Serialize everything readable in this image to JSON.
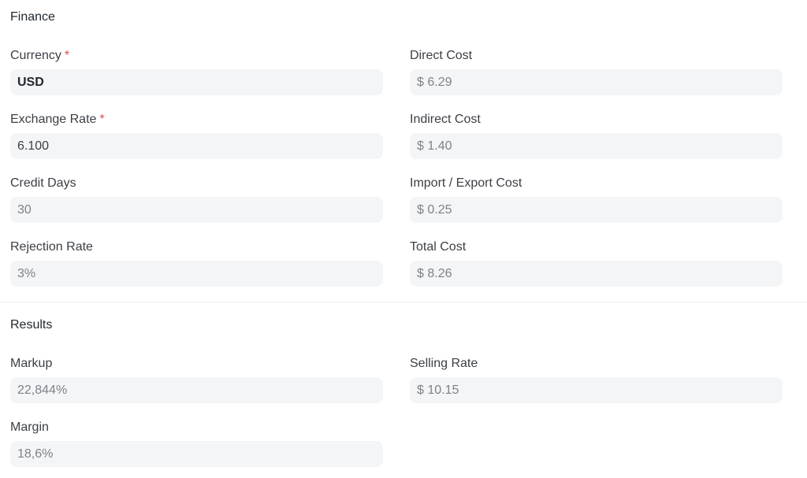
{
  "finance": {
    "title": "Finance",
    "required_mark": "*",
    "left": [
      {
        "key": "currency",
        "label": "Currency",
        "value": "USD",
        "required": true
      },
      {
        "key": "exchange_rate",
        "label": "Exchange Rate",
        "value": "6.100",
        "required": true
      },
      {
        "key": "credit_days",
        "label": "Credit Days",
        "value": "30",
        "required": false
      },
      {
        "key": "rejection_rate",
        "label": "Rejection Rate",
        "value": "3%",
        "required": false
      }
    ],
    "right": [
      {
        "key": "direct_cost",
        "label": "Direct Cost",
        "value": "$ 6.29"
      },
      {
        "key": "indirect_cost",
        "label": "Indirect Cost",
        "value": "$ 1.40"
      },
      {
        "key": "import_export_cost",
        "label": "Import / Export Cost",
        "value": "$ 0.25"
      },
      {
        "key": "total_cost",
        "label": "Total Cost",
        "value": "$ 8.26"
      }
    ]
  },
  "results": {
    "title": "Results",
    "left": [
      {
        "key": "markup",
        "label": "Markup",
        "value": "22,844%"
      },
      {
        "key": "margin",
        "label": "Margin",
        "value": "18,6%"
      }
    ],
    "right": [
      {
        "key": "selling_rate",
        "label": "Selling Rate",
        "value": "$ 10.15"
      }
    ]
  }
}
